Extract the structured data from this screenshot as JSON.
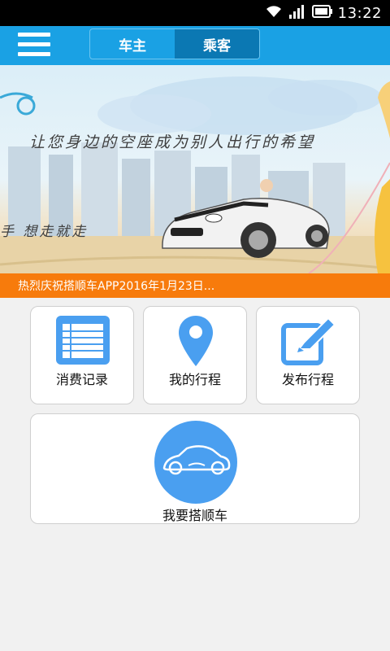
{
  "status_bar": {
    "time": "13:22",
    "icons": [
      "wifi-icon",
      "signal-icon",
      "battery-icon"
    ]
  },
  "header": {
    "menu_icon": "hamburger-menu-icon",
    "tabs": [
      {
        "label": "车主",
        "active": false
      },
      {
        "label": "乘客",
        "active": true
      }
    ]
  },
  "banner": {
    "slogan": "让您身边的空座成为别人出行的希望",
    "slogan2": "手 想走就走"
  },
  "notice": {
    "text": "热烈庆祝搭顺车APP2016年1月23日..."
  },
  "menu": {
    "items": [
      {
        "label": "消费记录",
        "icon": "list-record-icon"
      },
      {
        "label": "我的行程",
        "icon": "location-pin-icon"
      },
      {
        "label": "发布行程",
        "icon": "edit-pencil-icon"
      }
    ],
    "main": {
      "label": "我要搭顺车",
      "icon": "car-icon"
    }
  },
  "colors": {
    "header": "#1aa1e4",
    "toggle_active": "#0b78b3",
    "notice": "#f77b0c",
    "icon_blue": "#4a9ff0"
  }
}
